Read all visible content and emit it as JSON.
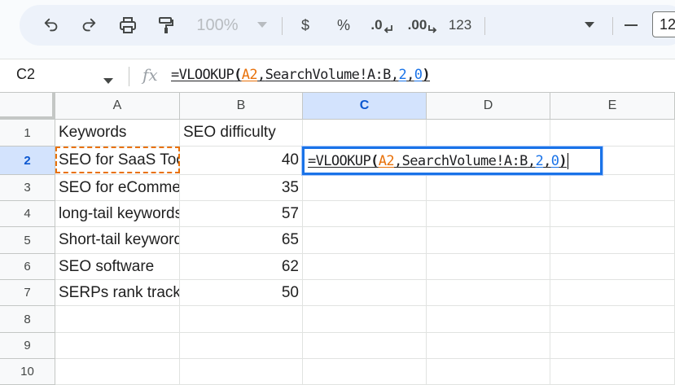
{
  "toolbar": {
    "zoom": "100%",
    "currency": "$",
    "percent": "%",
    "decrease_decimal": ".0",
    "increase_decimal": ".00",
    "number_format": "123",
    "font_size": "12"
  },
  "formula_bar": {
    "name_box": "C2",
    "fx": "fx",
    "tokens": {
      "t1": "=VLOOKUP",
      "t2": "(",
      "t3": "A2",
      "t4": ",",
      "t5": "SearchVolume!A:B",
      "t6": ",",
      "t7": "2",
      "t8": ",",
      "t9": "0",
      "t10": ")"
    }
  },
  "sheet": {
    "columns": [
      "A",
      "B",
      "C",
      "D",
      "E"
    ],
    "rows": [
      "1",
      "2",
      "3",
      "4",
      "5",
      "6",
      "7",
      "8",
      "9",
      "10"
    ],
    "cells": {
      "a1": "Keywords",
      "b1": "SEO difficulty",
      "a2": "SEO for SaaS Tools",
      "b2": "40",
      "a3": "SEO for eCommerce",
      "b3": "35",
      "a4": "long-tail keywords",
      "b4": "57",
      "a5": "Short-tail keywords",
      "b5": "65",
      "a6": "SEO software",
      "b6": "62",
      "a7": "SERPs rank tracker",
      "b7": "50"
    }
  },
  "colors": {
    "accent": "#1a73e8",
    "reference": "#e8710a",
    "selected_header": "#d3e3fd"
  }
}
